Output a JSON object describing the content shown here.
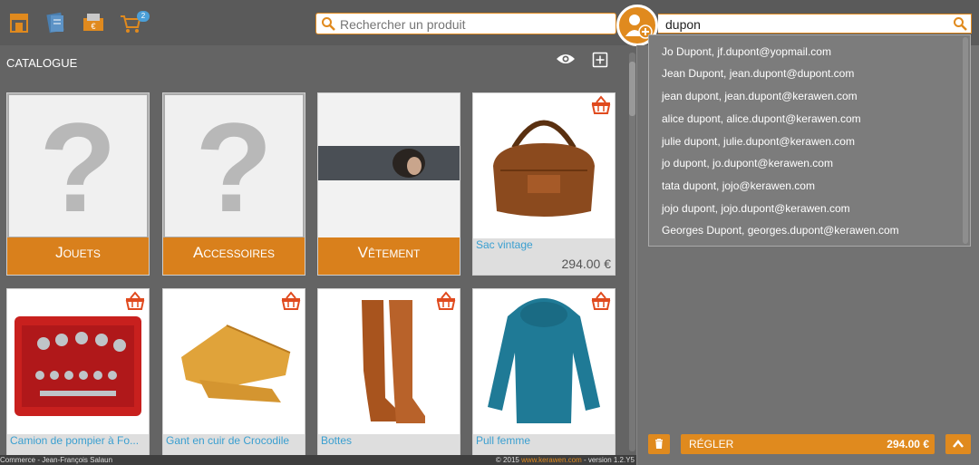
{
  "colors": {
    "accent": "#e08a1e",
    "link": "#3a9fd0",
    "panel": "#727272"
  },
  "topbar": {
    "icons": [
      "shop-icon",
      "catalog-icon",
      "ticket-icon",
      "cart-icon"
    ],
    "cart_badge": "2"
  },
  "search_product": {
    "placeholder": "Rechercher un produit",
    "value": ""
  },
  "search_customer": {
    "value": "dupon"
  },
  "catalogue": {
    "title": "CATALOGUE",
    "categories": [
      {
        "label": "Jouets"
      },
      {
        "label": "Accessoires"
      },
      {
        "label": "Vêtement"
      }
    ],
    "products": [
      {
        "name": "Sac vintage",
        "price": "294.00 €"
      },
      {
        "name": "Camion de pompier à Fo..."
      },
      {
        "name": "Gant en cuir de Crocodile"
      },
      {
        "name": "Bottes"
      },
      {
        "name": "Pull femme"
      }
    ]
  },
  "suggestions": [
    "Jo Dupont, jf.dupont@yopmail.com",
    "Jean Dupont, jean.dupont@dupont.com",
    "jean dupont, jean.dupont@kerawen.com",
    "alice dupont, alice.dupont@kerawen.com",
    "julie dupont, julie.dupont@kerawen.com",
    "jo dupont, jo.dupont@kerawen.com",
    "tata dupont, jojo@kerawen.com",
    "jojo dupont, jojo.dupont@kerawen.com",
    "Georges Dupont, georges.dupont@kerawen.com"
  ],
  "cart": {
    "pay_label": "RÉGLER",
    "total": "294.00 €"
  },
  "footer": {
    "left": "Commerce - Jean-François Salaun",
    "copyright": "© 2015 ",
    "link": "www.kerawen.com",
    "version": " - version 1.2.Y5"
  }
}
